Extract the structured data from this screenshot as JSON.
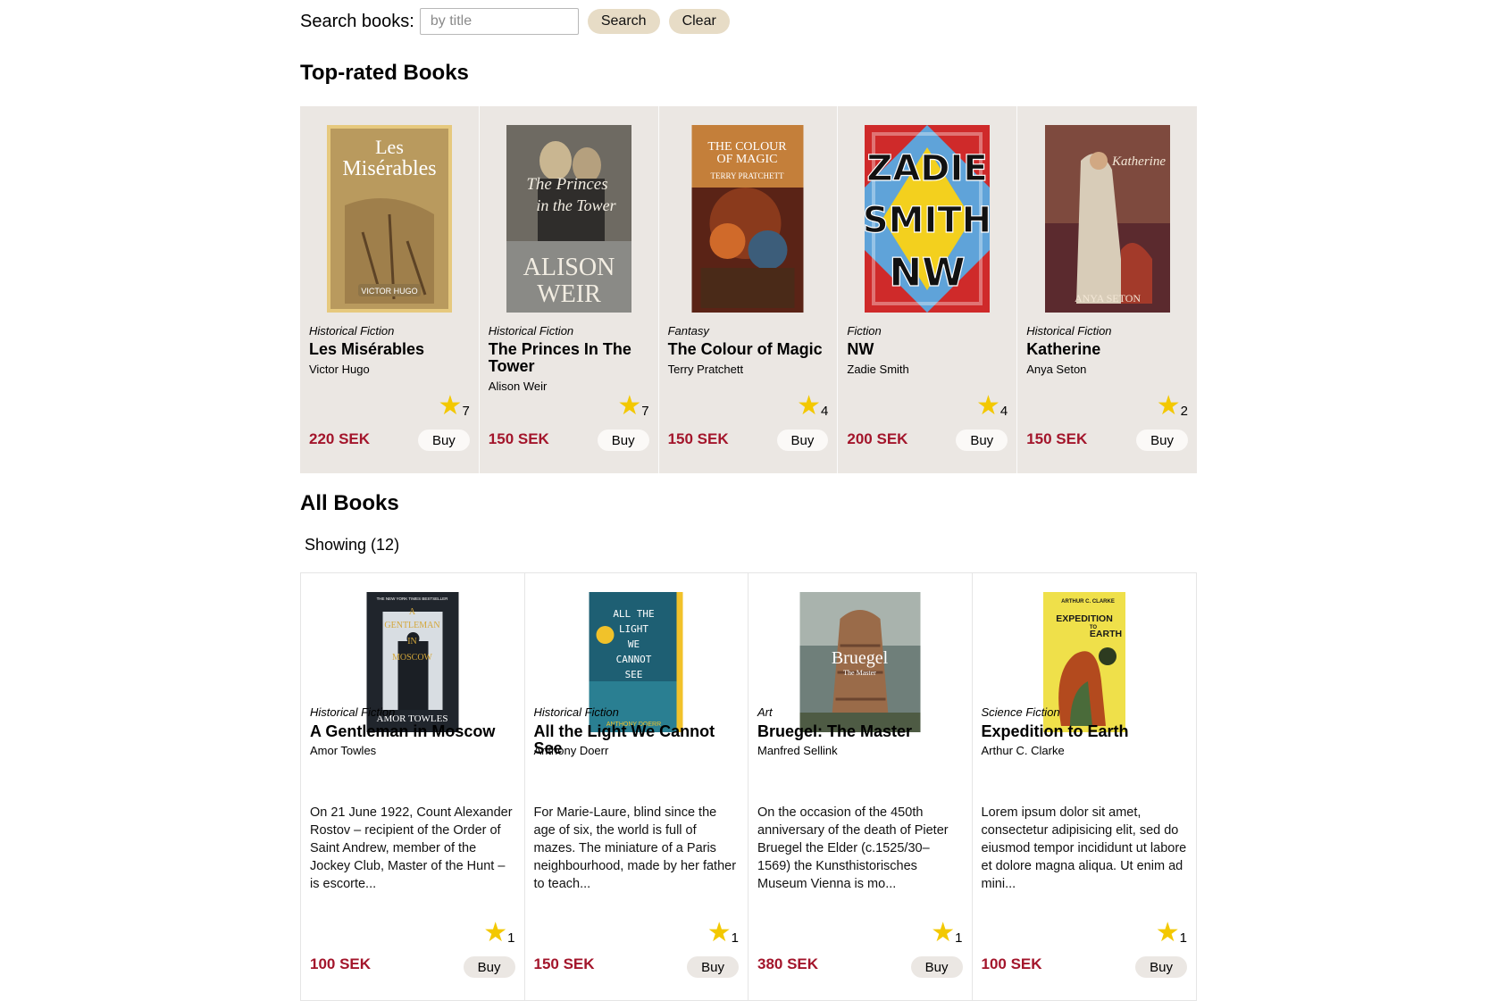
{
  "search": {
    "label": "Search books:",
    "placeholder": "by title",
    "value": "",
    "search_button": "Search",
    "clear_button": "Clear"
  },
  "top_rated": {
    "heading": "Top-rated Books",
    "books": [
      {
        "genre": "Historical Fiction",
        "title": "Les Misérables",
        "author": "Victor Hugo",
        "rating": "7",
        "price": "220 SEK",
        "buy": "Buy",
        "cover": {
          "line1": "Les",
          "line2": "Misérables",
          "footer": "VICTOR HUGO"
        }
      },
      {
        "genre": "Historical Fiction",
        "title": "The Princes In The Tower",
        "author": "Alison Weir",
        "rating": "7",
        "price": "150 SEK",
        "buy": "Buy",
        "cover": {
          "line1": "The Princes",
          "line2": "in the Tower",
          "footer1": "ALISON",
          "footer2": "WEIR"
        }
      },
      {
        "genre": "Fantasy",
        "title": "The Colour of Magic",
        "author": "Terry Pratchett",
        "rating": "4",
        "price": "150 SEK",
        "buy": "Buy",
        "cover": {
          "line1": "THE COLOUR",
          "line2": "OF MAGIC",
          "footer": "TERRY PRATCHETT"
        }
      },
      {
        "genre": "Fiction",
        "title": "NW",
        "author": "Zadie Smith",
        "rating": "4",
        "price": "200 SEK",
        "buy": "Buy",
        "cover": {
          "line1": "ZADIE",
          "line2": "SMITH",
          "line3": "NW"
        }
      },
      {
        "genre": "Historical Fiction",
        "title": "Katherine",
        "author": "Anya Seton",
        "rating": "2",
        "price": "150 SEK",
        "buy": "Buy",
        "cover": {
          "line1": "Katherine",
          "footer": "ANYA SETON"
        }
      }
    ]
  },
  "all_books": {
    "heading": "All Books",
    "showing": "Showing (12)",
    "books": [
      {
        "genre": "Historical Fiction",
        "title": "A Gentleman in Moscow",
        "author": "Amor Towles",
        "description": "On 21 June 1922, Count Alexander Rostov – recipient of the Order of Saint Andrew, member of the Jockey Club, Master of the Hunt – is escorte...",
        "rating": "1",
        "price": "100 SEK",
        "buy": "Buy",
        "cover": {
          "top": "THE NEW YORK TIMES BESTSELLER",
          "l1": "A",
          "l2": "GENTLEMAN",
          "l3": "IN",
          "l4": "MOSCOW",
          "footer": "AMOR TOWLES"
        }
      },
      {
        "genre": "Historical Fiction",
        "title": "All the Light We Cannot See",
        "author": "Anthony Doerr",
        "description": "For Marie-Laure, blind since the age of six, the world is full of mazes. The miniature of a Paris neighbourhood, made by her father to teach...",
        "rating": "1",
        "price": "150 SEK",
        "buy": "Buy",
        "cover": {
          "l1": "ALL THE",
          "l2": "LIGHT",
          "l3": "WE",
          "l4": "CANNOT",
          "l5": "SEE",
          "footer": "ANTHONY DOERR"
        }
      },
      {
        "genre": "Art",
        "title": "Bruegel: The Master",
        "author": "Manfred Sellink",
        "description": "On the occasion of the 450th anniversary of the death of Pieter Bruegel the Elder (c.1525/30–1569) the Kunsthistorisches Museum Vienna is mo...",
        "rating": "1",
        "price": "380 SEK",
        "buy": "Buy",
        "cover": {
          "l1": "Bruegel",
          "l2": "The Master"
        }
      },
      {
        "genre": "Science Fiction",
        "title": "Expedition to Earth",
        "author": "Arthur C. Clarke",
        "description": "Lorem ipsum dolor sit amet, consectetur adipisicing elit, sed do eiusmod tempor incididunt ut labore et dolore magna aliqua. Ut enim ad mini...",
        "rating": "1",
        "price": "100 SEK",
        "buy": "Buy",
        "cover": {
          "top": "ARTHUR C. CLARKE",
          "l1": "EXPEDITION",
          "l2": "TO",
          "l3": "EARTH"
        }
      }
    ]
  },
  "colors": {
    "accent_price": "#a3152b",
    "star": "#f3c800",
    "button_beige": "#e7dcc6",
    "card_bg": "#ebe7e3"
  },
  "icons": {
    "rating": "star-icon"
  }
}
